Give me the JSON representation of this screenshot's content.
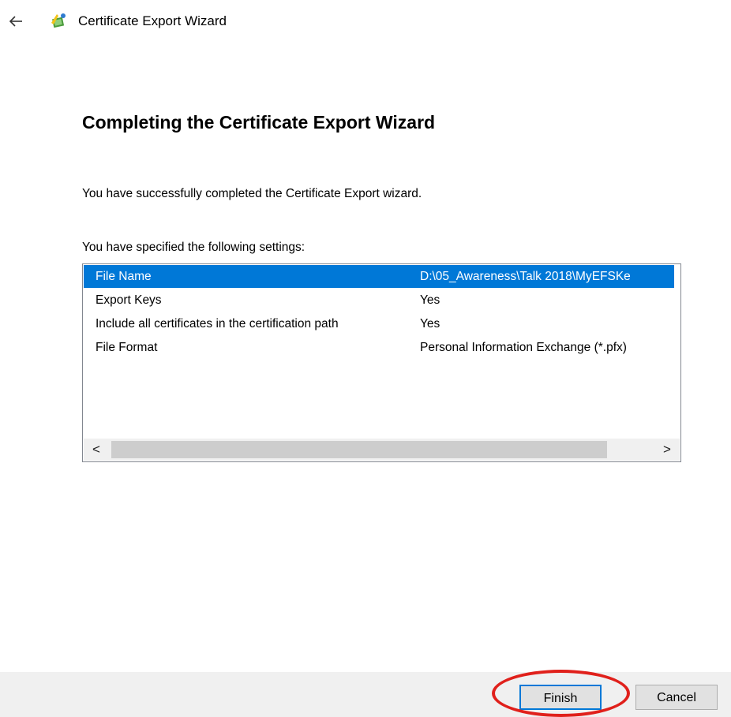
{
  "window": {
    "title": "Certificate Export Wizard"
  },
  "page": {
    "heading": "Completing the Certificate Export Wizard",
    "message": "You have successfully completed the Certificate Export wizard.",
    "settings_label": "You have specified the following settings:"
  },
  "settings": [
    {
      "name": "File Name",
      "value": "D:\\05_Awareness\\Talk 2018\\MyEFSKe"
    },
    {
      "name": "Export Keys",
      "value": "Yes"
    },
    {
      "name": "Include all certificates in the certification path",
      "value": "Yes"
    },
    {
      "name": "File Format",
      "value": "Personal Information Exchange (*.pfx)"
    }
  ],
  "scrollbar": {
    "left_arrow": "<",
    "right_arrow": ">"
  },
  "buttons": {
    "finish": "Finish",
    "cancel": "Cancel"
  },
  "colors": {
    "selection": "#0078d7",
    "highlight_ring": "#e0201b",
    "footer_bg": "#f0f0f0"
  },
  "icons": {
    "back": "back-arrow-icon",
    "wizard": "certificate-wizard-icon"
  }
}
